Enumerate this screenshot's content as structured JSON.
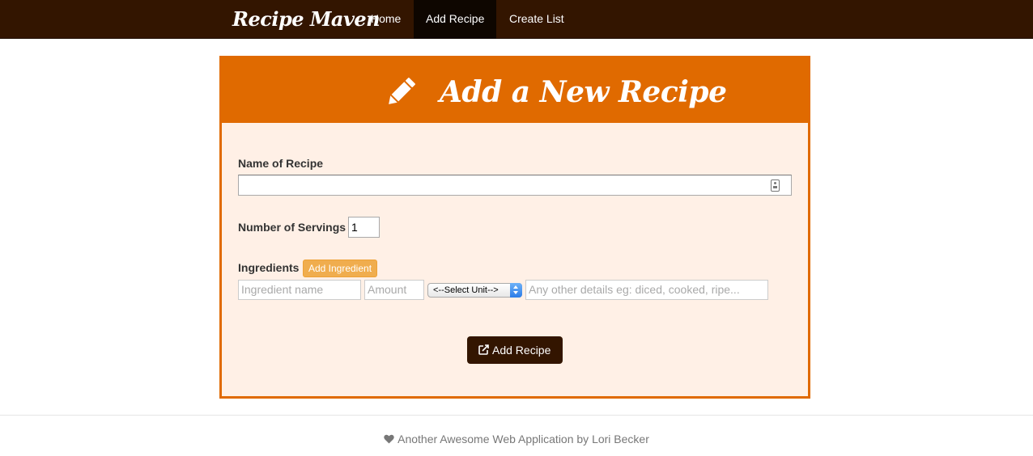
{
  "nav": {
    "brand": "Recipe Maven",
    "items": [
      {
        "label": "Home",
        "active": false
      },
      {
        "label": "Add Recipe",
        "active": true
      },
      {
        "label": "Create List",
        "active": false
      }
    ]
  },
  "panel": {
    "title": "Add a New Recipe",
    "icon": "pencil-icon"
  },
  "form": {
    "name_label": "Name of Recipe",
    "name_value": "",
    "servings_label": "Number of Servings",
    "servings_value": "1",
    "ingredients_label": "Ingredients",
    "add_ingredient_label": "Add Ingredient",
    "ingredient_name_placeholder": "Ingredient name",
    "amount_placeholder": "Amount",
    "unit_selected": "<--Select Unit-->",
    "details_placeholder": "Any other details eg: diced, cooked, ripe...",
    "submit_label": "Add Recipe"
  },
  "footer": {
    "text": "Another Awesome Web Application by Lori Becker"
  },
  "colors": {
    "nav_bg": "#331500",
    "accent": "#e06a00",
    "panel_bg": "#fff0e6",
    "warning": "#f0ad4e"
  }
}
